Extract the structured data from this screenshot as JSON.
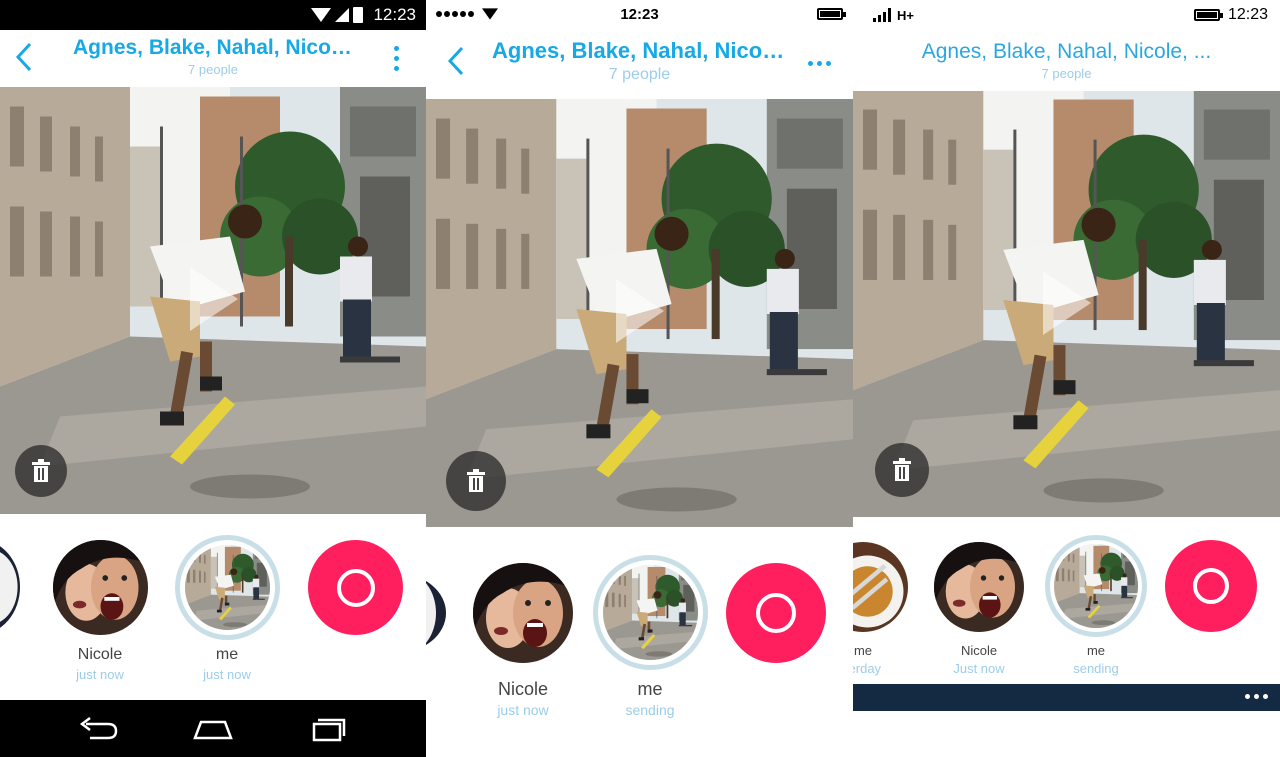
{
  "conversation": {
    "title": "Agnes, Blake, Nahal, Nicole, ...",
    "members": "7 people"
  },
  "status": {
    "android_time": "12:23",
    "ios_time": "12:23",
    "wp_time": "12:23",
    "wp_network": "H+"
  },
  "recipients": [
    {
      "name": "Nicole",
      "time": "just now"
    },
    {
      "name": "me",
      "time": "sending"
    }
  ],
  "screens": {
    "android": {
      "me_time": "just now"
    },
    "ios": {
      "me_time": "sending"
    },
    "wp": {
      "prev_name": "me",
      "prev_time": "terday",
      "nicole_time": "Just now",
      "me_time": "sending"
    }
  },
  "icons": {
    "back": "chevron-left-icon",
    "overflow": "more-vertical-icon",
    "play": "play-icon",
    "delete": "trash-icon",
    "record": "record-icon"
  },
  "colors": {
    "accent": "#16a9e6",
    "subtitle": "#9ccde8",
    "record": "#ff1f5e",
    "appbar": "#142a42"
  }
}
